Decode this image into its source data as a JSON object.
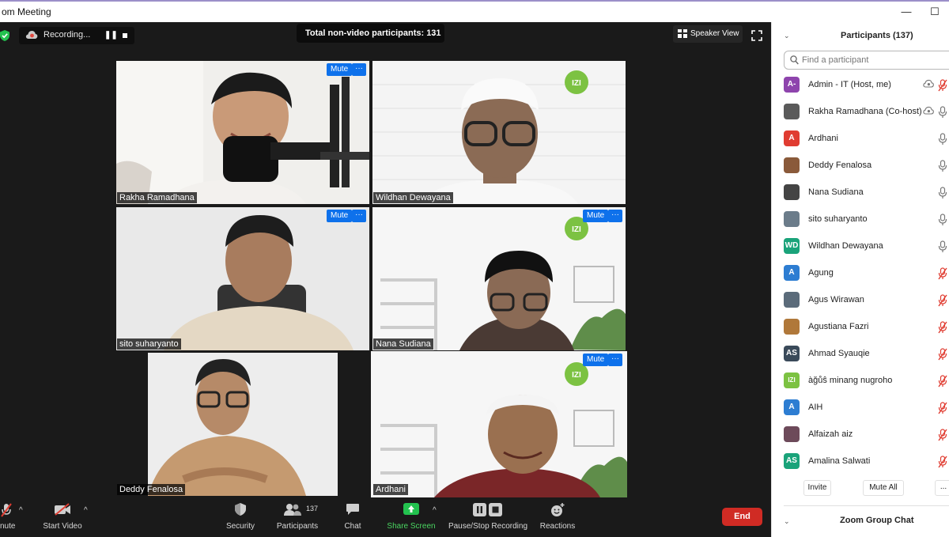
{
  "window": {
    "title": "om Meeting",
    "minimize": "—",
    "maximize": "☐"
  },
  "topbar": {
    "recording_label": "Recording...",
    "pause_glyph": "❚❚",
    "nonvideo_label": "Total non-video participants: 131",
    "speaker_view_label": "Speaker View",
    "caret": "⌄"
  },
  "tiles": [
    {
      "name": "Rakha Ramadhana",
      "mute": "Mute",
      "more": "···",
      "show_controls": true
    },
    {
      "name": "Wildhan Dewayana",
      "mute": "",
      "more": "",
      "show_controls": false
    },
    {
      "name": "sito suharyanto",
      "mute": "Mute",
      "more": "···",
      "show_controls": true
    },
    {
      "name": "Nana Sudiana",
      "mute": "Mute",
      "more": "···",
      "show_controls": true
    },
    {
      "name": "Deddy Fenalosa",
      "mute": "",
      "more": "",
      "show_controls": false
    },
    {
      "name": "Ardhani",
      "mute": "Mute",
      "more": "···",
      "show_controls": true
    }
  ],
  "toolbar": {
    "mute_label": "nute",
    "start_video_label": "Start Video",
    "security_label": "Security",
    "participants_label": "Participants",
    "participants_count": "137",
    "chat_label": "Chat",
    "share_screen_label": "Share Screen",
    "pause_stop_label": "Pause/Stop Recording",
    "reactions_label": "Reactions",
    "end_label": "End",
    "caret": "^"
  },
  "panel": {
    "title": "Participants (137)",
    "search_placeholder": "Find a participant",
    "invite_label": "Invite",
    "mute_all_label": "Mute All",
    "more_label": "...",
    "chat_title": "Zoom Group Chat",
    "chevron": "⌄"
  },
  "participants": [
    {
      "name": "Admin - IT (Host, me)",
      "avatar_text": "A-",
      "avatar_color": "#8e44ad",
      "cloud": true,
      "mic": "muted"
    },
    {
      "name": "Rakha Ramadhana (Co-host)",
      "avatar_text": "",
      "avatar_color": "#5a5a5a",
      "cloud": true,
      "mic": "on"
    },
    {
      "name": "Ardhani",
      "avatar_text": "A",
      "avatar_color": "#e03c31",
      "cloud": false,
      "mic": "on"
    },
    {
      "name": "Deddy Fenalosa",
      "avatar_text": "",
      "avatar_color": "#8a5a3a",
      "cloud": false,
      "mic": "on"
    },
    {
      "name": "Nana Sudiana",
      "avatar_text": "",
      "avatar_color": "#444444",
      "cloud": false,
      "mic": "on"
    },
    {
      "name": "sito suharyanto",
      "avatar_text": "",
      "avatar_color": "#6b7c8a",
      "cloud": false,
      "mic": "on"
    },
    {
      "name": "Wildhan Dewayana",
      "avatar_text": "WD",
      "avatar_color": "#1aa37a",
      "cloud": false,
      "mic": "on"
    },
    {
      "name": "Agung",
      "avatar_text": "A",
      "avatar_color": "#2d7dd2",
      "cloud": false,
      "mic": "muted"
    },
    {
      "name": "Agus Wirawan",
      "avatar_text": "",
      "avatar_color": "#5b6b7a",
      "cloud": false,
      "mic": "muted"
    },
    {
      "name": "Agustiana Fazri",
      "avatar_text": "",
      "avatar_color": "#b0783a",
      "cloud": false,
      "mic": "muted"
    },
    {
      "name": "Ahmad Syauqie",
      "avatar_text": "AS",
      "avatar_color": "#3a4a5a",
      "cloud": false,
      "mic": "muted"
    },
    {
      "name": "àğůŝ minang nugroho",
      "avatar_text": "IZI",
      "avatar_color": "#7cc242",
      "cloud": false,
      "mic": "muted"
    },
    {
      "name": "AIH",
      "avatar_text": "A",
      "avatar_color": "#2d7dd2",
      "cloud": false,
      "mic": "muted"
    },
    {
      "name": "Alfaizah aiz",
      "avatar_text": "",
      "avatar_color": "#6d4a5a",
      "cloud": false,
      "mic": "muted"
    },
    {
      "name": "Amalina Salwati",
      "avatar_text": "AS",
      "avatar_color": "#1aa37a",
      "cloud": false,
      "mic": "muted"
    }
  ]
}
